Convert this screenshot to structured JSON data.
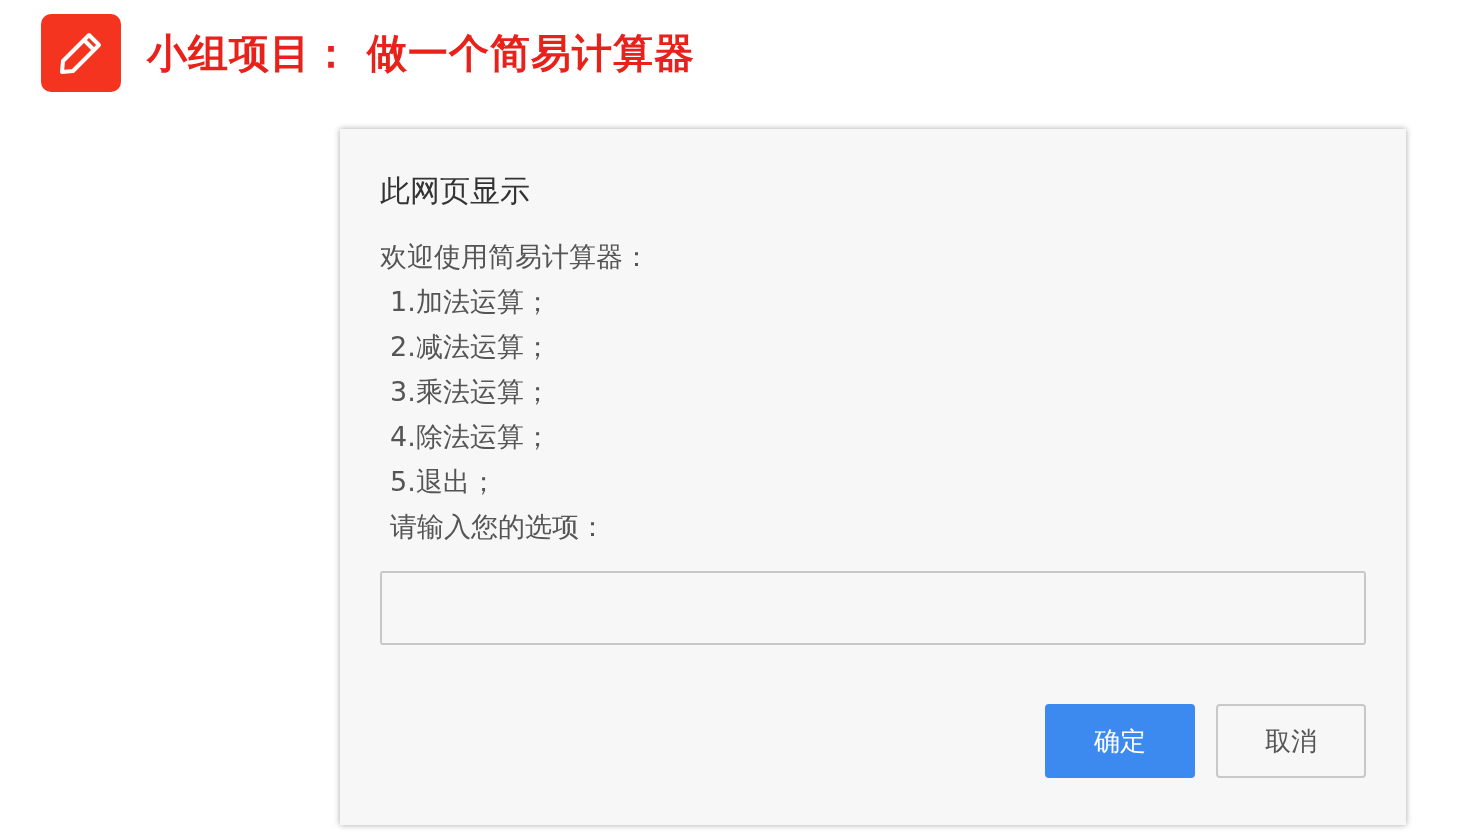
{
  "header": {
    "title": "小组项目： 做一个简易计算器"
  },
  "dialog": {
    "title": "此网页显示",
    "message_lines": [
      {
        "kind": "intro",
        "text": "欢迎使用简易计算器："
      },
      {
        "kind": "item",
        "text": "1.加法运算；"
      },
      {
        "kind": "item",
        "text": "2.减法运算；"
      },
      {
        "kind": "item",
        "text": "3.乘法运算；"
      },
      {
        "kind": "item",
        "text": "4.除法运算；"
      },
      {
        "kind": "item",
        "text": "5.退出；"
      },
      {
        "kind": "item",
        "text": "请输入您的选项："
      }
    ],
    "buttons": [
      {
        "label": "确定",
        "kind": "primary"
      },
      {
        "label": "取消",
        "kind": "secondary"
      }
    ]
  }
}
